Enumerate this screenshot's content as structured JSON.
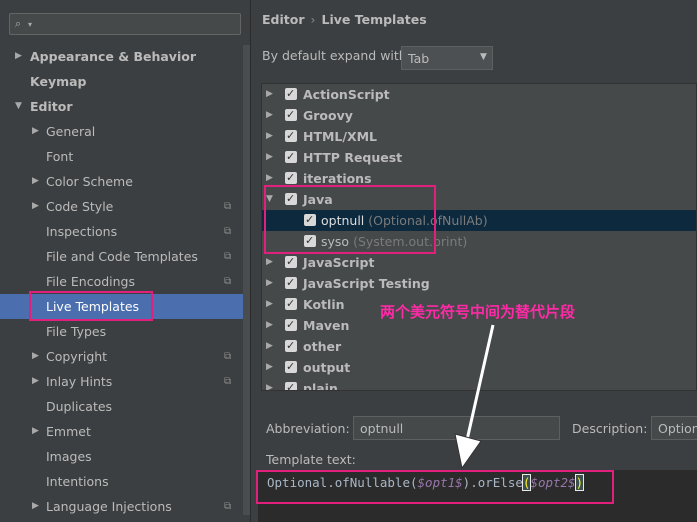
{
  "sidebar": {
    "search_placeholder": "Q▾",
    "items": [
      {
        "label": "Appearance & Behavior",
        "arrow": "▶",
        "bold": true,
        "copy": false
      },
      {
        "label": "Keymap",
        "arrow": "",
        "bold": true,
        "copy": false
      },
      {
        "label": "Editor",
        "arrow": "▼",
        "bold": true,
        "copy": false
      },
      {
        "label": "General",
        "arrow": "▶",
        "bold": false,
        "copy": false
      },
      {
        "label": "Font",
        "arrow": "",
        "bold": false,
        "copy": false
      },
      {
        "label": "Color Scheme",
        "arrow": "▶",
        "bold": false,
        "copy": false
      },
      {
        "label": "Code Style",
        "arrow": "▶",
        "bold": false,
        "copy": true
      },
      {
        "label": "Inspections",
        "arrow": "",
        "bold": false,
        "copy": true
      },
      {
        "label": "File and Code Templates",
        "arrow": "",
        "bold": false,
        "copy": true
      },
      {
        "label": "File Encodings",
        "arrow": "",
        "bold": false,
        "copy": true
      },
      {
        "label": "Live Templates",
        "arrow": "",
        "bold": false,
        "copy": false,
        "selected": true
      },
      {
        "label": "File Types",
        "arrow": "",
        "bold": false,
        "copy": false
      },
      {
        "label": "Copyright",
        "arrow": "▶",
        "bold": false,
        "copy": true
      },
      {
        "label": "Inlay Hints",
        "arrow": "▶",
        "bold": false,
        "copy": true
      },
      {
        "label": "Duplicates",
        "arrow": "",
        "bold": false,
        "copy": false
      },
      {
        "label": "Emmet",
        "arrow": "▶",
        "bold": false,
        "copy": false
      },
      {
        "label": "Images",
        "arrow": "",
        "bold": false,
        "copy": false
      },
      {
        "label": "Intentions",
        "arrow": "",
        "bold": false,
        "copy": false
      },
      {
        "label": "Language Injections",
        "arrow": "▶",
        "bold": false,
        "copy": true
      }
    ]
  },
  "breadcrumb": {
    "root": "Editor",
    "separator": "›",
    "page": "Live Templates"
  },
  "expand": {
    "label": "By default expand with",
    "value": "Tab"
  },
  "templates": [
    {
      "name": "ActionScript",
      "arrow": "▶",
      "level": 0
    },
    {
      "name": "Groovy",
      "arrow": "▶",
      "level": 0
    },
    {
      "name": "HTML/XML",
      "arrow": "▶",
      "level": 0
    },
    {
      "name": "HTTP Request",
      "arrow": "▶",
      "level": 0
    },
    {
      "name": "iterations",
      "arrow": "▶",
      "level": 0
    },
    {
      "name": "Java",
      "arrow": "▼",
      "level": 0
    },
    {
      "name": "optnull",
      "desc": "(Optional.ofNullAb)",
      "arrow": "",
      "level": 1,
      "selected": true
    },
    {
      "name": "syso",
      "desc": "(System.out.print)",
      "arrow": "",
      "level": 1
    },
    {
      "name": "JavaScript",
      "arrow": "▶",
      "level": 0
    },
    {
      "name": "JavaScript Testing",
      "arrow": "▶",
      "level": 0
    },
    {
      "name": "Kotlin",
      "arrow": "▶",
      "level": 0
    },
    {
      "name": "Maven",
      "arrow": "▶",
      "level": 0
    },
    {
      "name": "other",
      "arrow": "▶",
      "level": 0
    },
    {
      "name": "output",
      "arrow": "▶",
      "level": 0
    },
    {
      "name": "plain",
      "arrow": "▶",
      "level": 0
    }
  ],
  "annotation": "两个美元符号中间为替代片段",
  "abbreviation": {
    "label": "Abbreviation:",
    "value": "optnull"
  },
  "description": {
    "label": "Description:",
    "value": "Option"
  },
  "template_text": {
    "label": "Template text:",
    "p1": "Optional.ofNullable(",
    "v1": "$opt1$",
    "p2": ").orElse",
    "p3": "(",
    "v2": "$opt2$",
    "p4": ")"
  },
  "colors": {
    "accent": "#4b6eaf",
    "highlight": "#e0207c",
    "annotation": "#ff2aa6"
  }
}
